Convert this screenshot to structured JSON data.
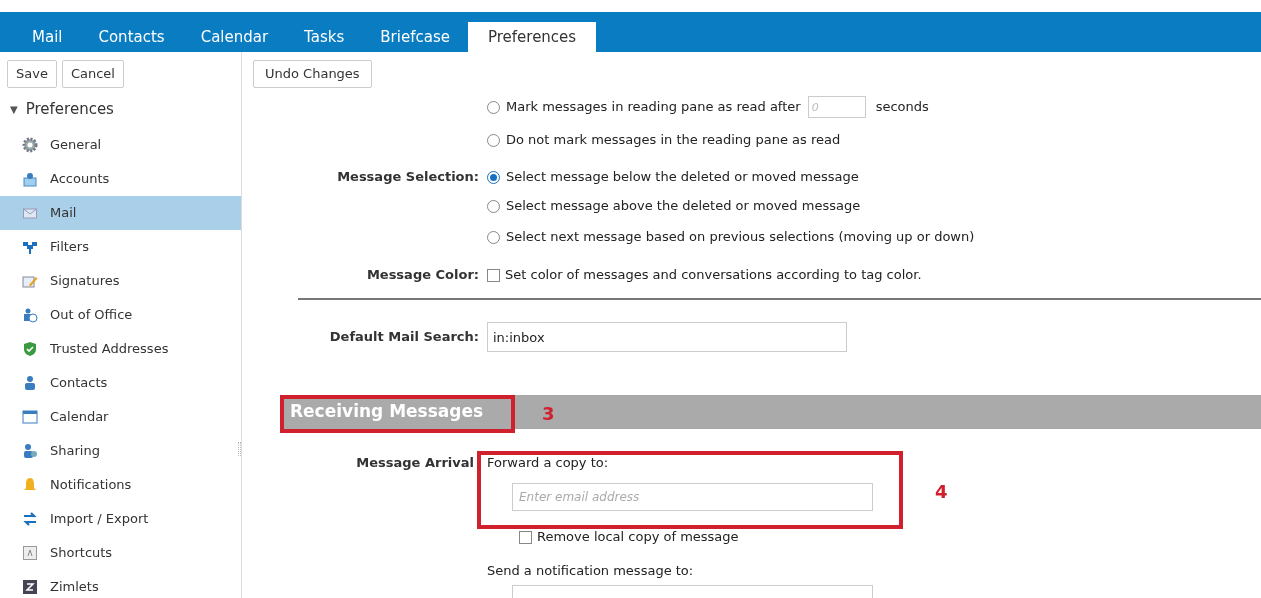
{
  "tabs": [
    {
      "label": "Mail",
      "selected": false
    },
    {
      "label": "Contacts",
      "selected": false
    },
    {
      "label": "Calendar",
      "selected": false
    },
    {
      "label": "Tasks",
      "selected": false
    },
    {
      "label": "Briefcase",
      "selected": false
    },
    {
      "label": "Preferences",
      "selected": true
    }
  ],
  "toolbar": {
    "left_buttons": [
      "Save",
      "Cancel"
    ],
    "right_buttons": [
      "Undo Changes"
    ]
  },
  "sidebar": {
    "caret": "▼",
    "expanded": true,
    "title": "Preferences",
    "items": [
      {
        "label": "General",
        "selected": false
      },
      {
        "label": "Accounts",
        "selected": false
      },
      {
        "label": "Mail",
        "selected": true
      },
      {
        "label": "Filters",
        "selected": false
      },
      {
        "label": "Signatures",
        "selected": false
      },
      {
        "label": "Out of Office",
        "selected": false
      },
      {
        "label": "Trusted Addresses",
        "selected": false
      },
      {
        "label": "Contacts",
        "selected": false
      },
      {
        "label": "Calendar",
        "selected": false
      },
      {
        "label": "Sharing",
        "selected": false
      },
      {
        "label": "Notifications",
        "selected": false
      },
      {
        "label": "Import / Export",
        "selected": false
      },
      {
        "label": "Shortcuts",
        "selected": false
      },
      {
        "label": "Zimlets",
        "selected": false
      }
    ]
  },
  "reading_pane": {
    "options": [
      {
        "label": "Mark messages in reading pane as read after",
        "selected": false,
        "field_placeholder": "0",
        "suffix": "seconds"
      },
      {
        "label": "Do not mark messages in the reading pane as read",
        "selected": false
      }
    ]
  },
  "message_selection": {
    "label": "Message Selection:",
    "options": [
      {
        "label": "Select message below the deleted or moved message",
        "selected": true
      },
      {
        "label": "Select message above the deleted or moved message",
        "selected": false
      },
      {
        "label": "Select next message based on previous selections (moving up or down)",
        "selected": false
      }
    ]
  },
  "message_color": {
    "label": "Message Color:",
    "checkbox": {
      "label": "Set color of messages and conversations according to tag color.",
      "checked": false
    }
  },
  "default_mail_search": {
    "label": "Default Mail Search:",
    "value": "in:inbox"
  },
  "section_header": "Receiving Messages",
  "message_arrival": {
    "label": "Message Arrival",
    "forward_label": "Forward a copy to:",
    "forward_placeholder": "Enter email address",
    "remove_copy": {
      "label": "Remove local copy of message",
      "checked": false
    },
    "notify_label": "Send a notification message to:"
  },
  "annotations": [
    "3",
    "4"
  ]
}
